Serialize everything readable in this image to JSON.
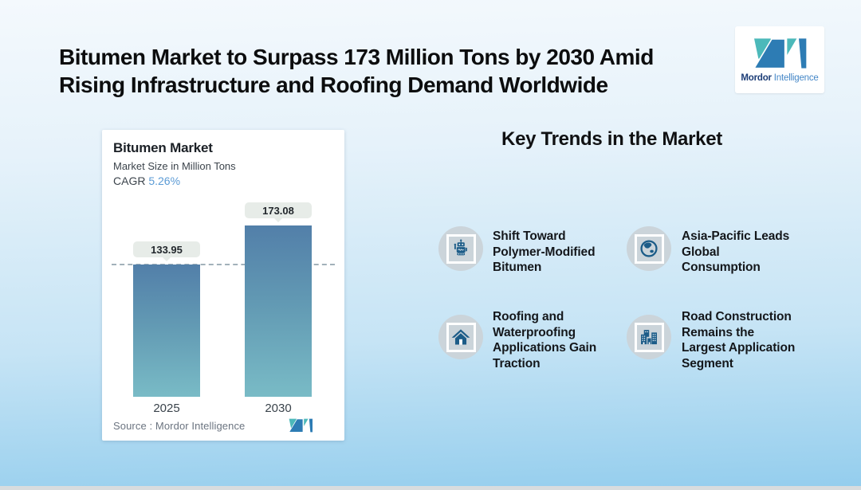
{
  "page": {
    "title": "Bitumen Market to Surpass 173 Million Tons by 2030 Amid\nRising Infrastructure and Roofing Demand Worldwide"
  },
  "logo": {
    "name_bold": "Mordor",
    "name_light": " Intelligence"
  },
  "chart_card": {
    "title": "Bitumen Market",
    "subtitle": "Market Size in Million Tons",
    "cagr_label": "CAGR ",
    "cagr_value": "5.26%",
    "source": "Source :  Mordor Intelligence"
  },
  "chart_data": {
    "type": "bar",
    "title": "Bitumen Market",
    "ylabel": "Market Size in Million Tons",
    "cagr": "5.26%",
    "categories": [
      "2025",
      "2030"
    ],
    "values": [
      133.95,
      173.08
    ],
    "value_labels": [
      "133.95",
      "173.08"
    ],
    "reference_line_value": 133.95,
    "grid": false,
    "legend": false,
    "source": "Mordor Intelligence"
  },
  "trends": {
    "heading": "Key Trends in the Market",
    "items": [
      {
        "icon": "robot-icon",
        "text": "Shift Toward\nPolymer-Modified\nBitumen"
      },
      {
        "icon": "globe-icon",
        "text": "Asia-Pacific Leads\nGlobal\nConsumption"
      },
      {
        "icon": "home-icon",
        "text": "Roofing and\nWaterproofing\nApplications Gain\nTraction"
      },
      {
        "icon": "buildings-icon",
        "text": "Road Construction\nRemains the\nLargest Application\nSegment"
      }
    ]
  },
  "colors": {
    "background_top": "#f4f9fd",
    "background_bottom": "#93cded",
    "bar_top": "#527fa9",
    "bar_bottom": "#79bbc6",
    "cagr_accent": "#5b9bd5",
    "pill_bg": "#e7ece8",
    "icon_circle": "#cbd4da",
    "icon_glyph": "#1c5c88",
    "brand_teal": "#4cb9ba",
    "brand_blue": "#2d7cb4"
  }
}
